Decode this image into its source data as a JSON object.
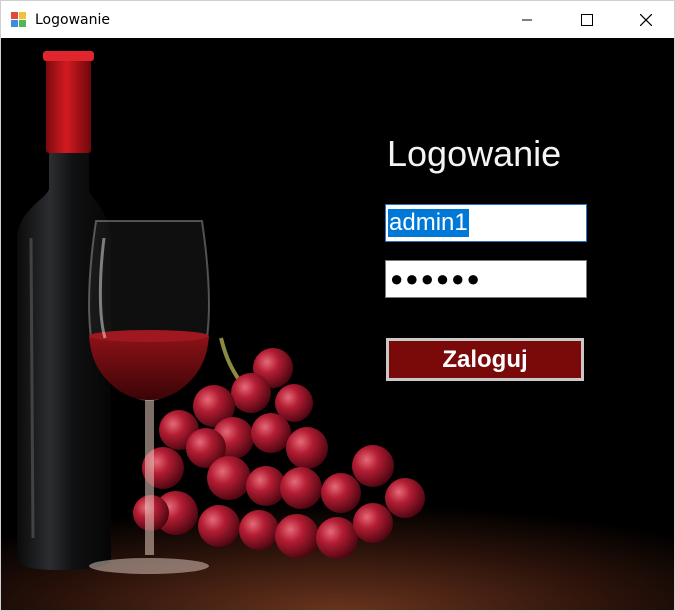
{
  "window": {
    "title": "Logowanie",
    "controls": {
      "minimize_icon": "minimize-icon",
      "maximize_icon": "maximize-icon",
      "close_icon": "close-icon"
    }
  },
  "form": {
    "heading": "Logowanie",
    "username": {
      "value": "admin1",
      "selected": true
    },
    "password": {
      "masked_value": "●●●●●●",
      "length": 6
    },
    "login_label": "Zaloguj"
  },
  "background": {
    "subject": "wine-bottle-glass-grapes",
    "colors": {
      "wine": "#8b0f14",
      "bottle_cap": "#c4141a",
      "table": "#5a2a18"
    }
  },
  "colors": {
    "button_fill": "#7a0a0a",
    "selection": "#0078d7"
  }
}
